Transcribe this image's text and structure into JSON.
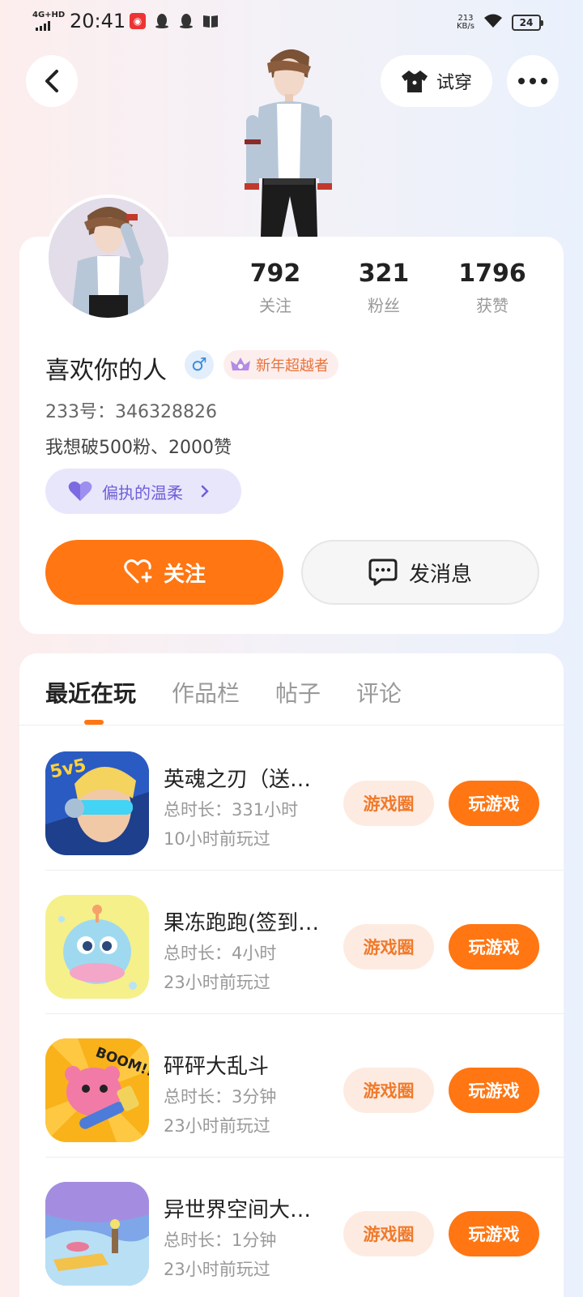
{
  "status_bar": {
    "network": "4G+HD",
    "time": "20:41",
    "speed": "213",
    "speed_unit": "KB/s",
    "battery": "24"
  },
  "header": {
    "try_on_label": "试穿"
  },
  "profile": {
    "stats": [
      {
        "value": "792",
        "label": "关注"
      },
      {
        "value": "321",
        "label": "粉丝"
      },
      {
        "value": "1796",
        "label": "获赞"
      }
    ],
    "username": "喜欢你的人",
    "gender_symbol": "♂",
    "title_badge": "新年超越者",
    "user_id": "233号：346328826",
    "bio": "我想破500粉、2000赞",
    "tag_label": "偏执的温柔",
    "follow_label": "关注",
    "message_label": "发消息"
  },
  "tabs": [
    {
      "label": "最近在玩",
      "active": true
    },
    {
      "label": "作品栏",
      "active": false
    },
    {
      "label": "帖子",
      "active": false
    },
    {
      "label": "评论",
      "active": false
    }
  ],
  "games": [
    {
      "name": "英魂之刃（送…",
      "duration": "总时长：331小时",
      "last_played": "10小时前玩过",
      "circle_label": "游戏圈",
      "play_label": "玩游戏"
    },
    {
      "name": "果冻跑跑(签到…",
      "duration": "总时长：4小时",
      "last_played": "23小时前玩过",
      "circle_label": "游戏圈",
      "play_label": "玩游戏"
    },
    {
      "name": "砰砰大乱斗",
      "duration": "总时长：3分钟",
      "last_played": "23小时前玩过",
      "circle_label": "游戏圈",
      "play_label": "玩游戏"
    },
    {
      "name": "异世界空间大…",
      "duration": "总时长：1分钟",
      "last_played": "23小时前玩过",
      "circle_label": "游戏圈",
      "play_label": "玩游戏"
    }
  ],
  "game_icon_texts": {
    "game1": "5v5",
    "game3": "BOOM!!"
  },
  "colors": {
    "accent": "#ff7612",
    "accent_light": "#fdebe2",
    "tag_bg": "#e8e6fb",
    "gender": "#3e8bdc"
  }
}
